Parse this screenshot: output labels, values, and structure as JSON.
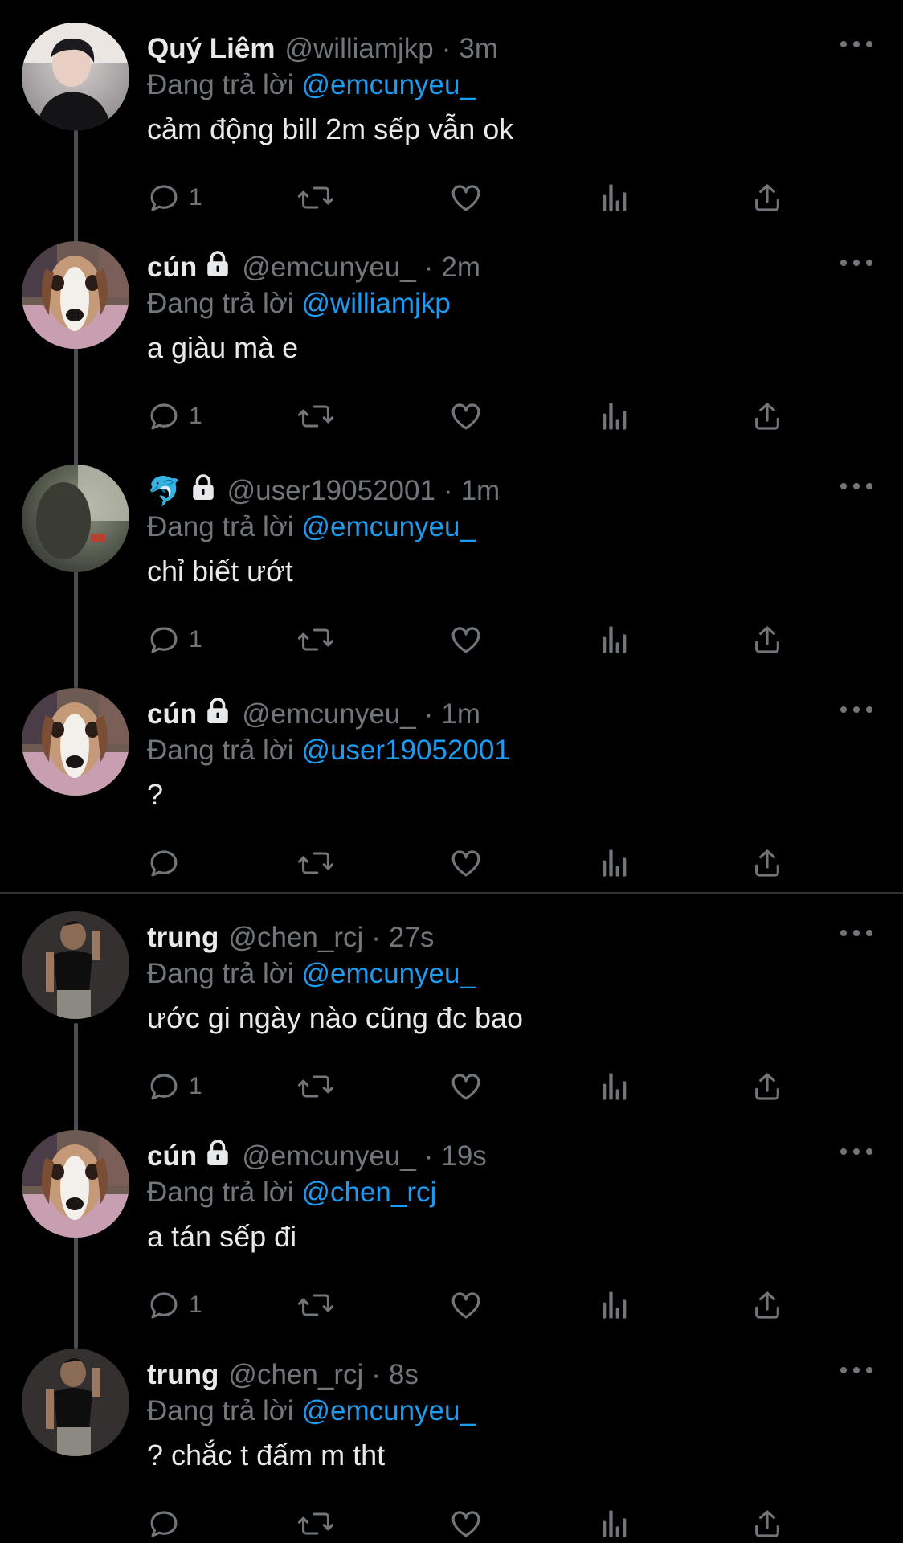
{
  "reply_prefix": "Đang trả lời",
  "colors": {
    "background": "#000000",
    "text": "#e7e9ea",
    "muted": "#71767b",
    "link": "#1d9bf0",
    "thread_line": "#4a4d52"
  },
  "icons": {
    "reply": "reply-icon",
    "retweet": "retweet-icon",
    "like": "heart-icon",
    "views": "views-icon",
    "share": "share-icon",
    "more": "more-icon",
    "lock": "lock-icon"
  },
  "tweets": [
    {
      "name": "Quý Liêm",
      "handle": "@williamjkp",
      "time": "3m",
      "reply_to": "@emcunyeu_",
      "text": "cảm động bill 2m sếp vẫn ok",
      "reply_count": "1"
    },
    {
      "name": "cún",
      "handle": "@emcunyeu_",
      "time": "2m",
      "reply_to": "@williamjkp",
      "text": "a giàu mà e",
      "reply_count": "1"
    },
    {
      "name": "🐬",
      "handle": "@user19052001",
      "time": "1m",
      "reply_to": "@emcunyeu_",
      "text": "chỉ biết ướt",
      "reply_count": "1"
    },
    {
      "name": "cún",
      "handle": "@emcunyeu_",
      "time": "1m",
      "reply_to": "@user19052001",
      "text": "?",
      "reply_count": ""
    },
    {
      "name": "trung",
      "handle": "@chen_rcj",
      "time": "27s",
      "reply_to": "@emcunyeu_",
      "text": "ước gi ngày nào cũng đc bao",
      "reply_count": "1"
    },
    {
      "name": "cún",
      "handle": "@emcunyeu_",
      "time": "19s",
      "reply_to": "@chen_rcj",
      "text": "a tán sếp đi",
      "reply_count": "1"
    },
    {
      "name": "trung",
      "handle": "@chen_rcj",
      "time": "8s",
      "reply_to": "@emcunyeu_",
      "text": "? chắc t đấm m tht",
      "reply_count": ""
    }
  ]
}
